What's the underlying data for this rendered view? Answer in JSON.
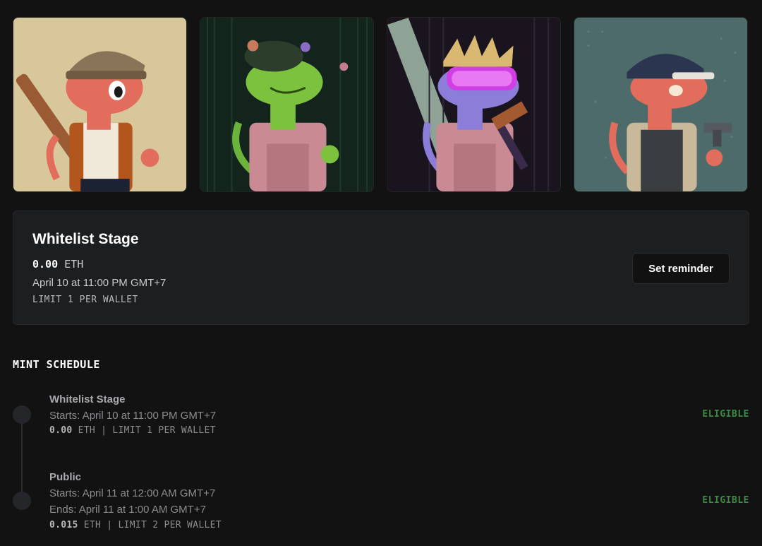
{
  "gallery": {
    "items": [
      {
        "name": "nft-1",
        "bg": "#d7c79a"
      },
      {
        "name": "nft-2",
        "bg": "#12241c"
      },
      {
        "name": "nft-3",
        "bg": "#1a141f"
      },
      {
        "name": "nft-4",
        "bg": "#4c6b6a"
      }
    ]
  },
  "stage": {
    "title": "Whitelist Stage",
    "price_value": "0.00",
    "price_unit": "ETH",
    "date": "April 10 at 11:00 PM GMT+7",
    "limit": "LIMIT 1 PER WALLET",
    "reminder_label": "Set reminder"
  },
  "schedule": {
    "heading": "MINT SCHEDULE",
    "items": [
      {
        "name": "Whitelist Stage",
        "starts": "Starts: April 10 at 11:00 PM GMT+7",
        "price_value": "0.00",
        "meta_rest": "ETH | LIMIT 1 PER WALLET",
        "status": "ELIGIBLE"
      },
      {
        "name": "Public",
        "starts": "Starts: April 11 at 12:00 AM GMT+7",
        "ends": "Ends: April 11 at 1:00 AM GMT+7",
        "price_value": "0.015",
        "meta_rest": "ETH | LIMIT 2 PER WALLET",
        "status": "ELIGIBLE"
      }
    ]
  },
  "colors": {
    "background": "#121212",
    "card": "#1d1e20",
    "eligible": "#3e8a45"
  }
}
